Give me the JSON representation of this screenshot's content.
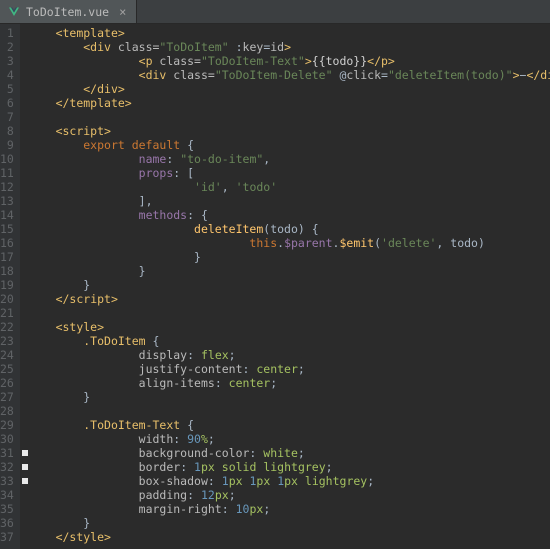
{
  "tab": {
    "filename": "ToDoItem.vue",
    "close_glyph": "×"
  },
  "gutter": {
    "markers": {
      "31": true,
      "32": true,
      "33": true
    }
  },
  "lines": {
    "1": {
      "in": 1,
      "t": [
        [
          "tag",
          "<template>"
        ]
      ]
    },
    "2": {
      "in": 2,
      "t": [
        [
          "tag",
          "<div "
        ],
        [
          "attr",
          "class="
        ],
        [
          "str",
          "\"ToDoItem\""
        ],
        [
          "punc",
          " :"
        ],
        [
          "attr",
          "key"
        ],
        [
          "punc",
          "="
        ],
        [
          "attr",
          "id"
        ],
        [
          "tag",
          ">"
        ]
      ]
    },
    "3": {
      "in": 4,
      "t": [
        [
          "tag",
          "<p "
        ],
        [
          "attr",
          "class="
        ],
        [
          "str",
          "\"ToDoItem-Text\""
        ],
        [
          "tag",
          ">"
        ],
        [
          "mustache",
          "{{todo}}"
        ],
        [
          "tag",
          "</p>"
        ]
      ]
    },
    "4": {
      "in": 4,
      "t": [
        [
          "tag",
          "<div "
        ],
        [
          "attr",
          "class="
        ],
        [
          "str",
          "\"ToDoItem-Delete\""
        ],
        [
          "punc",
          " @"
        ],
        [
          "attr",
          "click"
        ],
        [
          "punc",
          "="
        ],
        [
          "str",
          "\"deleteItem(todo)\""
        ],
        [
          "tag",
          ">"
        ],
        [
          "punc",
          "−"
        ],
        [
          "tag",
          "</div>"
        ]
      ]
    },
    "5": {
      "in": 2,
      "t": [
        [
          "tag",
          "</div>"
        ]
      ]
    },
    "6": {
      "in": 1,
      "t": [
        [
          "tag",
          "</template>"
        ]
      ]
    },
    "7": {
      "in": 0,
      "t": []
    },
    "8": {
      "in": 1,
      "t": [
        [
          "tag",
          "<script>"
        ]
      ]
    },
    "9": {
      "in": 2,
      "t": [
        [
          "kw",
          "export default"
        ],
        [
          "punc",
          " {"
        ]
      ]
    },
    "10": {
      "in": 4,
      "t": [
        [
          "key",
          "name"
        ],
        [
          "punc",
          ": "
        ],
        [
          "str",
          "\"to-do-item\""
        ],
        [
          "punc",
          ","
        ]
      ]
    },
    "11": {
      "in": 4,
      "t": [
        [
          "key",
          "props"
        ],
        [
          "punc",
          ": ["
        ]
      ]
    },
    "12": {
      "in": 6,
      "t": [
        [
          "str",
          "'id'"
        ],
        [
          "punc",
          ", "
        ],
        [
          "str",
          "'todo'"
        ]
      ]
    },
    "13": {
      "in": 4,
      "t": [
        [
          "punc",
          "],"
        ]
      ]
    },
    "14": {
      "in": 4,
      "t": [
        [
          "key",
          "methods"
        ],
        [
          "punc",
          ": {"
        ]
      ]
    },
    "15": {
      "in": 6,
      "t": [
        [
          "fn",
          "deleteItem"
        ],
        [
          "punc",
          "(todo) {"
        ]
      ]
    },
    "16": {
      "in": 8,
      "t": [
        [
          "kw",
          "this"
        ],
        [
          "punc",
          "."
        ],
        [
          "key",
          "$parent"
        ],
        [
          "punc",
          "."
        ],
        [
          "fn",
          "$emit"
        ],
        [
          "punc",
          "("
        ],
        [
          "str",
          "'delete'"
        ],
        [
          "punc",
          ", todo)"
        ]
      ]
    },
    "17": {
      "in": 6,
      "t": [
        [
          "punc",
          "}"
        ]
      ]
    },
    "18": {
      "in": 4,
      "t": [
        [
          "punc",
          "}"
        ]
      ]
    },
    "19": {
      "in": 2,
      "t": [
        [
          "punc",
          "}"
        ]
      ]
    },
    "20": {
      "in": 1,
      "t": [
        [
          "tag",
          "</"
        ],
        [
          "tag",
          "script>"
        ]
      ]
    },
    "21": {
      "in": 0,
      "t": []
    },
    "22": {
      "in": 1,
      "t": [
        [
          "tag",
          "<style>"
        ]
      ]
    },
    "23": {
      "in": 2,
      "t": [
        [
          "sel",
          ".ToDoItem"
        ],
        [
          "punc",
          " {"
        ]
      ]
    },
    "24": {
      "in": 4,
      "t": [
        [
          "prop",
          "display"
        ],
        [
          "punc",
          ": "
        ],
        [
          "val",
          "flex"
        ],
        [
          "punc",
          ";"
        ]
      ]
    },
    "25": {
      "in": 4,
      "t": [
        [
          "prop",
          "justify-content"
        ],
        [
          "punc",
          ": "
        ],
        [
          "val",
          "center"
        ],
        [
          "punc",
          ";"
        ]
      ]
    },
    "26": {
      "in": 4,
      "t": [
        [
          "prop",
          "align-items"
        ],
        [
          "punc",
          ": "
        ],
        [
          "val",
          "center"
        ],
        [
          "punc",
          ";"
        ]
      ]
    },
    "27": {
      "in": 2,
      "t": [
        [
          "punc",
          "}"
        ]
      ]
    },
    "28": {
      "in": 0,
      "t": []
    },
    "29": {
      "in": 2,
      "t": [
        [
          "sel",
          ".ToDoItem-Text"
        ],
        [
          "punc",
          " {"
        ]
      ]
    },
    "30": {
      "in": 4,
      "t": [
        [
          "prop",
          "width"
        ],
        [
          "punc",
          ": "
        ],
        [
          "num",
          "90"
        ],
        [
          "val",
          "%"
        ],
        [
          "punc",
          ";"
        ]
      ]
    },
    "31": {
      "in": 4,
      "t": [
        [
          "prop",
          "background-color"
        ],
        [
          "punc",
          ": "
        ],
        [
          "val",
          "white"
        ],
        [
          "punc",
          ";"
        ]
      ]
    },
    "32": {
      "in": 4,
      "t": [
        [
          "prop",
          "border"
        ],
        [
          "punc",
          ": "
        ],
        [
          "num",
          "1"
        ],
        [
          "val",
          "px "
        ],
        [
          "val",
          "solid"
        ],
        [
          "punc",
          " "
        ],
        [
          "val",
          "lightgrey"
        ],
        [
          "punc",
          ";"
        ]
      ]
    },
    "33": {
      "in": 4,
      "t": [
        [
          "prop",
          "box-shadow"
        ],
        [
          "punc",
          ": "
        ],
        [
          "num",
          "1"
        ],
        [
          "val",
          "px "
        ],
        [
          "num",
          "1"
        ],
        [
          "val",
          "px "
        ],
        [
          "num",
          "1"
        ],
        [
          "val",
          "px "
        ],
        [
          "val",
          "lightgrey"
        ],
        [
          "punc",
          ";"
        ]
      ]
    },
    "34": {
      "in": 4,
      "t": [
        [
          "prop",
          "padding"
        ],
        [
          "punc",
          ": "
        ],
        [
          "num",
          "12"
        ],
        [
          "val",
          "px"
        ],
        [
          "punc",
          ";"
        ]
      ]
    },
    "35": {
      "in": 4,
      "t": [
        [
          "prop",
          "margin-right"
        ],
        [
          "punc",
          ": "
        ],
        [
          "num",
          "10"
        ],
        [
          "val",
          "px"
        ],
        [
          "punc",
          ";"
        ]
      ]
    },
    "36": {
      "in": 2,
      "t": [
        [
          "punc",
          "}"
        ]
      ]
    },
    "37": {
      "in": 1,
      "t": [
        [
          "tag",
          "</style>"
        ]
      ]
    }
  },
  "total_lines": 37
}
